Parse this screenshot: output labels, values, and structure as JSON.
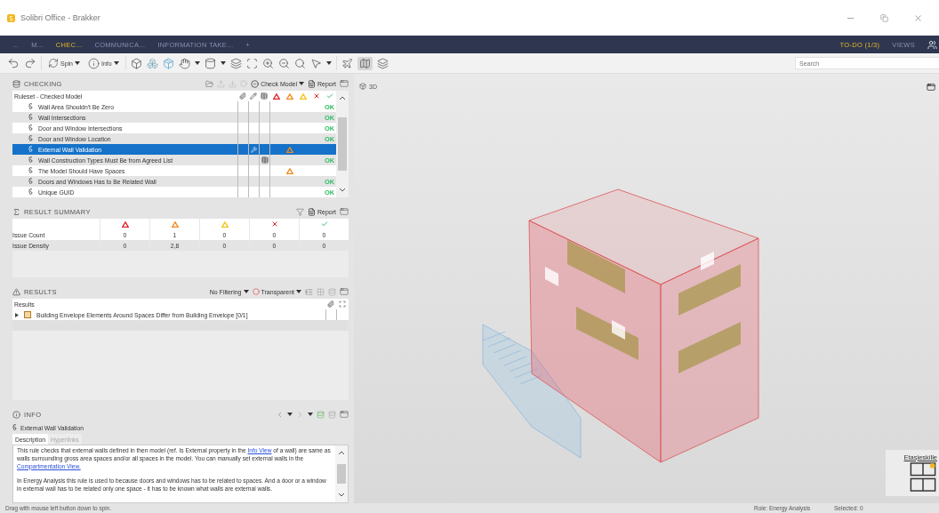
{
  "window": {
    "title": "Solibri Office - Brakker"
  },
  "nav": {
    "tabs": [
      {
        "label": "...",
        "selected": false
      },
      {
        "label": "M...",
        "selected": false
      },
      {
        "label": "CHEC...",
        "selected": true
      },
      {
        "label": "COMMUNICA...",
        "selected": false
      },
      {
        "label": "INFORMATION TAKE...",
        "selected": false
      },
      {
        "label": "+",
        "selected": false
      }
    ],
    "right": [
      {
        "label": "TO-DO (1/3)",
        "selected": true
      },
      {
        "label": "VIEWS",
        "selected": false
      }
    ]
  },
  "toolbar": {
    "spin_label": "Spin",
    "info_label": "Info",
    "search": {
      "placeholder": "Search"
    }
  },
  "checking": {
    "title": "CHECKING",
    "check_label": "Check Model",
    "report_label": "Report",
    "column_header": "Ruleset - Checked Model",
    "rows": [
      {
        "name": "Wall Area Shouldn't Be Zero",
        "selected": false,
        "edited": false,
        "tabled": false,
        "warning": false,
        "result": "OK"
      },
      {
        "name": "Wall Intersections",
        "selected": false,
        "edited": false,
        "tabled": false,
        "warning": false,
        "result": "OK"
      },
      {
        "name": "Door and Window Intersections",
        "selected": false,
        "edited": false,
        "tabled": false,
        "warning": false,
        "result": "OK"
      },
      {
        "name": "Door and Window Location",
        "selected": false,
        "edited": false,
        "tabled": false,
        "warning": false,
        "result": "OK"
      },
      {
        "name": "External Wall Validation",
        "selected": true,
        "edited": true,
        "tabled": false,
        "warning": true
      },
      {
        "name": "Wall Construction Types Must Be from Agreed List",
        "selected": false,
        "edited": false,
        "tabled": true,
        "warning": false,
        "result": "OK"
      },
      {
        "name": "The Model Should Have Spaces",
        "selected": false,
        "edited": false,
        "tabled": false,
        "warning": true
      },
      {
        "name": "Doors and Windows Has to Be Related Wall",
        "selected": false,
        "edited": false,
        "tabled": false,
        "warning": false,
        "result": "OK"
      },
      {
        "name": "Unique GUID",
        "selected": false,
        "edited": false,
        "tabled": false,
        "warning": false,
        "result": "OK"
      }
    ]
  },
  "summary": {
    "title": "RESULT SUMMARY",
    "report_label": "Report",
    "columns": [
      {
        "kind": "high"
      },
      {
        "kind": "moderate"
      },
      {
        "kind": "low"
      },
      {
        "kind": "rejected"
      },
      {
        "kind": "passed"
      }
    ],
    "rows": [
      {
        "label": "Issue Count",
        "values": [
          "0",
          "1",
          "0",
          "0",
          "0"
        ]
      },
      {
        "label": "Issue Density",
        "values": [
          "0",
          "2,8",
          "0",
          "0",
          "0"
        ]
      }
    ]
  },
  "results": {
    "title": "RESULTS",
    "filter_label": "No Filtering",
    "transparency_label": "Transparent",
    "column_header": "Results",
    "items": [
      {
        "label": "Building Envelope Elements Around Spaces Differ from Building Envelope [0/1]",
        "expanded": false
      }
    ]
  },
  "info": {
    "title": "INFO",
    "rule": "External Wall Validation",
    "tabs": [
      {
        "label": "Description",
        "selected": true
      },
      {
        "label": "Hyperlinks",
        "selected": false
      }
    ],
    "paragraphs": [
      [
        {
          "text": "This rule checks that external walls defined in then model (ref. Is External property in the "
        },
        {
          "text": "Info View",
          "link": true
        },
        {
          "text": " of a wall) are same as walls surrounding gross area spaces and/or all spaces in the model. You can manually set external walls in the "
        },
        {
          "text": "Compartmentation View.",
          "link": true
        }
      ],
      [
        {
          "text": "In Energy Analysis this rule is used to because doors and windows has to be related to spaces. And a door or a window in external wall has to be related only one space - it has to be known what walls are external walls."
        }
      ]
    ]
  },
  "viewport": {
    "title": "3D",
    "floor_widget": {
      "label": "Etasjeskille"
    }
  },
  "status_bar": {
    "hint": "Drag with mouse left button down to spin.",
    "role": "Role: Energy Analysis",
    "selected": "Selected: 0"
  }
}
